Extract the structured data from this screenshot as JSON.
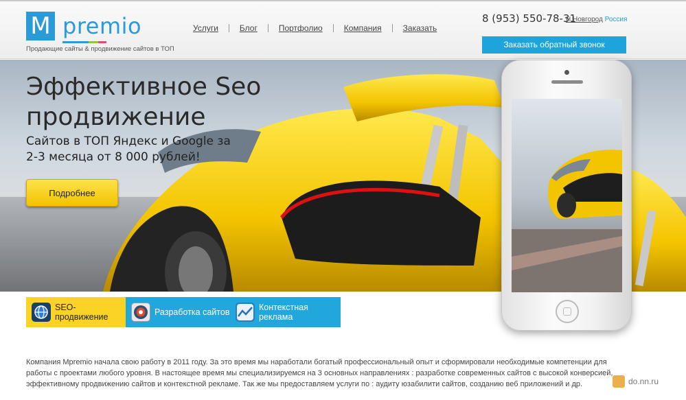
{
  "header": {
    "logo_letter": "M",
    "logo_name": "premio",
    "tagline": "Продающие сайты & продвижение сайтов в ТОП",
    "nav": [
      "Услуги",
      "Блог",
      "Портфолио",
      "Компания",
      "Заказать"
    ],
    "phone": "8 (953) 550-78-31",
    "city": "Н.Новгород",
    "country": "Россия",
    "callback_label": "Заказать обратный звонок"
  },
  "hero": {
    "title": "Эффективное Seo продвижение",
    "subtitle": "Сайтов в ТОП Яндекс и Google за 2-3 месяца от 8 000 рублей!",
    "more_label": "Подробнее"
  },
  "tabs": [
    {
      "label": "SEO-продвижение",
      "icon": "globe-icon"
    },
    {
      "label": "Разработка сайтов",
      "icon": "target-icon"
    },
    {
      "label": "Контекстная реклама",
      "icon": "chart-icon"
    }
  ],
  "about": "Компания Mpremio начала свою работу в 2011 году. За это время мы наработали богатый профессиональный опыт и сформировали необходимые компетенции для работы с проектами любого уровня. В настоящее время мы специализируемся на 3 основных направлениях : разработке современных сайтов с высокой конверсией, эффективному продвижению сайтов и контекстной рекламе. Так же мы предоставляем услуги по : аудиту юзабилити сайтов, созданию веб приложений и др.",
  "watermark": "do.nn.ru",
  "colors": {
    "accent": "#21a7dc",
    "yellow": "#fbd324",
    "brand": "#2a9bd6"
  }
}
